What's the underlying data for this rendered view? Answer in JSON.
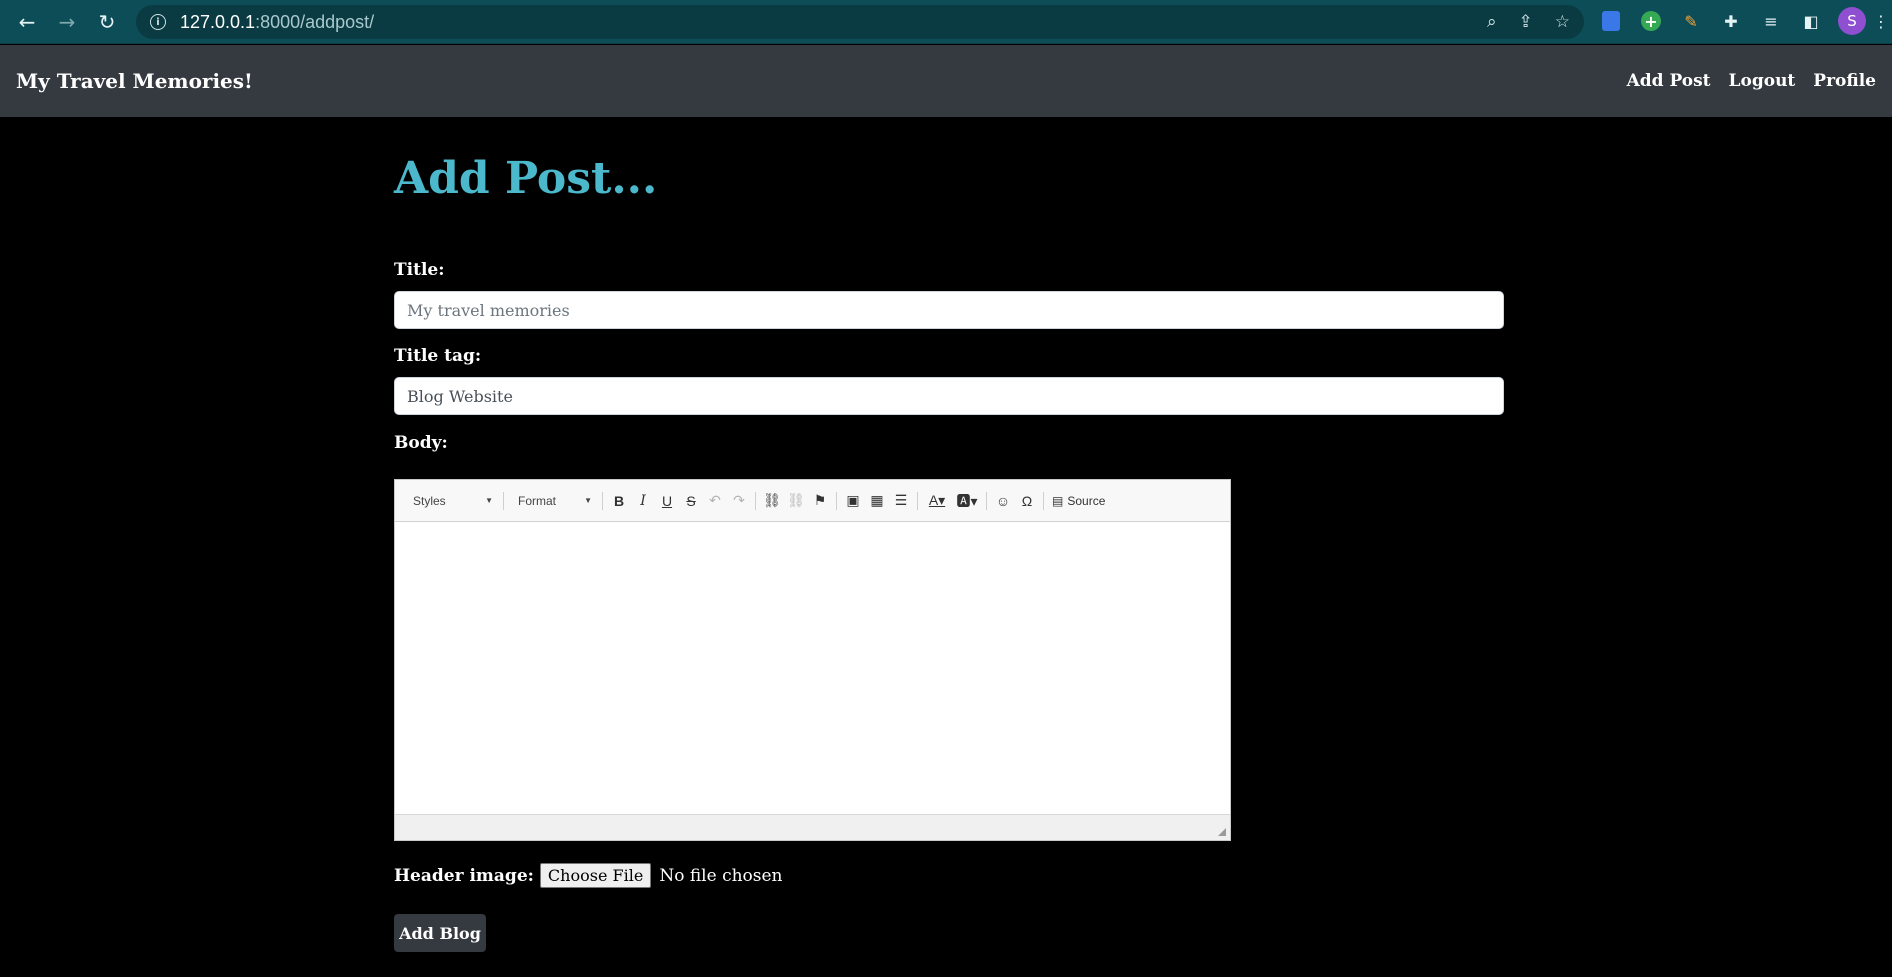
{
  "browser": {
    "url_host": "127.0.0.1",
    "url_rest": ":8000/addpost/",
    "avatar_letter": "S"
  },
  "navbar": {
    "brand": "My Travel Memories!",
    "links": [
      "Add Post",
      "Logout",
      "Profile"
    ]
  },
  "page": {
    "heading": "Add Post..."
  },
  "form": {
    "title_label": "Title:",
    "title_placeholder": "My travel memories",
    "title_tag_label": "Title tag:",
    "title_tag_value": "Blog Website",
    "body_label": "Body:",
    "editor": {
      "styles_combo": "Styles",
      "format_combo": "Format",
      "source_label": "Source"
    },
    "header_image_label": "Header image:",
    "choose_file_label": "Choose File",
    "file_status": "No file chosen",
    "submit_label": "Add Blog"
  },
  "colors": {
    "chrome": "#0d4d57",
    "navbar": "#343a40",
    "heading": "#4bb8cc",
    "background": "#000000"
  }
}
